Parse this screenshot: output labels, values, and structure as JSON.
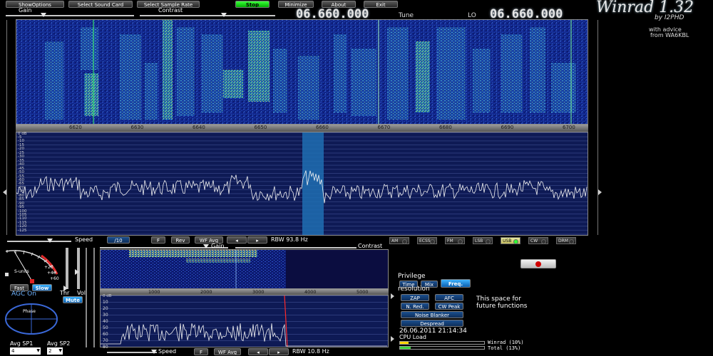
{
  "toolbar": {
    "show_options": "ShowOptions",
    "select_sound_card": "Select Sound Card",
    "select_sample_rate": "Select Sample Rate",
    "stop": "Stop",
    "minimize": "Minimize",
    "about": "About",
    "exit": "Exit"
  },
  "sliders_top": {
    "gain": "Gain",
    "contrast": "Contrast"
  },
  "tune": {
    "value": "06.660.000",
    "label": "Tune"
  },
  "lo": {
    "label": "LO",
    "value": "06.660.000"
  },
  "branding": {
    "title": "Winrad 1.32",
    "by": "by I2PHD",
    "advice_1": "with advice",
    "advice_2": "from WA6KBL"
  },
  "main_waterfall": {
    "ticks": [
      "6620",
      "6630",
      "6640",
      "6650",
      "6660",
      "6670",
      "6680",
      "6690",
      "6700"
    ]
  },
  "spectrum": {
    "scale_header": "0  dB",
    "db_labels": [
      "-5",
      "-10",
      "-15",
      "-20",
      "-25",
      "-30",
      "-35",
      "-40",
      "-45",
      "-50",
      "-55",
      "-60",
      "-65",
      "-70",
      "-75",
      "-80",
      "-85",
      "-90",
      "-95",
      "-100",
      "-105",
      "-110",
      "-115",
      "-120",
      "-125"
    ]
  },
  "main_controls": {
    "speed_label": "Speed",
    "speed_value": "/10",
    "f_btn": "F",
    "rev_btn": "Rev",
    "wf_avg_btn": "WF Avg",
    "rbw": "RBW 93.8 Hz"
  },
  "modes": [
    {
      "label": "AM",
      "on": false
    },
    {
      "label": "ECSS",
      "on": false
    },
    {
      "label": "FM",
      "on": false
    },
    {
      "label": "LSB",
      "on": false
    },
    {
      "label": "USB",
      "on": true
    },
    {
      "label": "CW",
      "on": false
    },
    {
      "label": "DRM",
      "on": false
    }
  ],
  "left_panel": {
    "s_units": "S-units",
    "s_scale": [
      "+20",
      "+40",
      "+60"
    ],
    "fast": "Fast",
    "slow": "Slow",
    "agc": "AGC On",
    "thr": "Thr",
    "vol": "Vol",
    "mute": "Mute",
    "phase": "Phase",
    "avg_sp1": "Avg SP1",
    "avg_sp2": "Avg SP2",
    "avg_sp1_value": "4",
    "avg_sp2_value": "2"
  },
  "audio": {
    "gain": "Gain",
    "contrast": "Contrast",
    "ticks": [
      "1000",
      "2000",
      "3000",
      "4000",
      "5000"
    ],
    "db_header": "0  dB",
    "db_labels": [
      "10",
      "20",
      "30",
      "40",
      "50",
      "60",
      "70",
      "80"
    ],
    "speed_label": "Speed",
    "f_btn": "F",
    "wf_avg_btn": "WF Avg",
    "rbw": "RBW 10.8 Hz"
  },
  "right_panel": {
    "privilege": "Privilege",
    "time": "Time",
    "mix": "Mix",
    "freq": "Freq.",
    "resolution": "resolution",
    "zap": "ZAP",
    "afc": "AFC",
    "nred": "N. Red.",
    "cwpeak": "CW Peak",
    "noise_blanker": "Noise Blanker",
    "despread": "Despread",
    "space_1": "This space for",
    "space_2": "future functions",
    "datetime": "26.06.2011  21:14:34",
    "cpu_load": "CPU Load",
    "winrad_load": "Winrad  (10%)",
    "total_load": "Total   (13%)"
  }
}
